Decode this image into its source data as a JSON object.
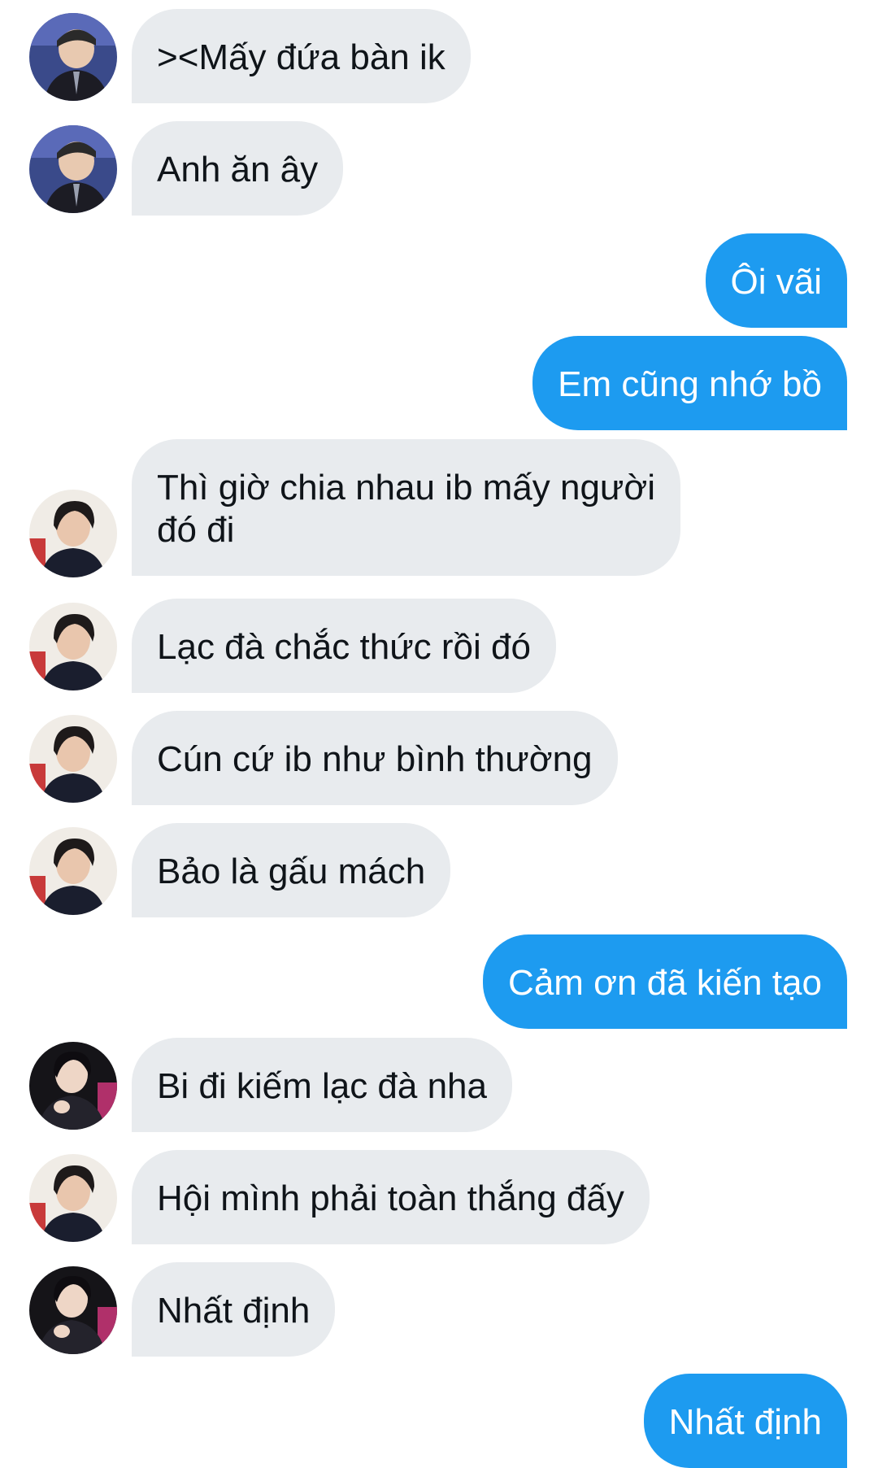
{
  "colors": {
    "incoming_bubble": "#e8ebee",
    "outgoing_bubble": "#1d9bf0",
    "incoming_text": "#0f1419",
    "outgoing_text": "#ffffff"
  },
  "messages": [
    {
      "direction": "in",
      "avatar": "person-a-avatar",
      "text": "><Mấy đứa bàn ik"
    },
    {
      "direction": "in",
      "avatar": "person-a-avatar",
      "text": "Anh ăn ây"
    },
    {
      "direction": "out",
      "text": "Ôi vãi"
    },
    {
      "direction": "out",
      "text": "Em cũng nhớ bồ"
    },
    {
      "direction": "in",
      "avatar": "person-b-avatar",
      "text": "Thì giờ chia nhau ib mấy người\nđó đi"
    },
    {
      "direction": "in",
      "avatar": "person-b-avatar",
      "text": "Lạc đà chắc thức rồi đó"
    },
    {
      "direction": "in",
      "avatar": "person-b-avatar",
      "text": "Cún cứ ib như bình thường"
    },
    {
      "direction": "in",
      "avatar": "person-b-avatar",
      "text": "Bảo là gấu mách"
    },
    {
      "direction": "out",
      "text": "Cảm ơn đã kiến tạo"
    },
    {
      "direction": "in",
      "avatar": "person-c-avatar",
      "text": "Bi đi kiếm lạc đà nha"
    },
    {
      "direction": "in",
      "avatar": "person-b-avatar",
      "text": "Hội mình phải toàn thắng đấy"
    },
    {
      "direction": "in",
      "avatar": "person-c-avatar",
      "text": "Nhất định"
    },
    {
      "direction": "out",
      "text": "Nhất định"
    }
  ]
}
